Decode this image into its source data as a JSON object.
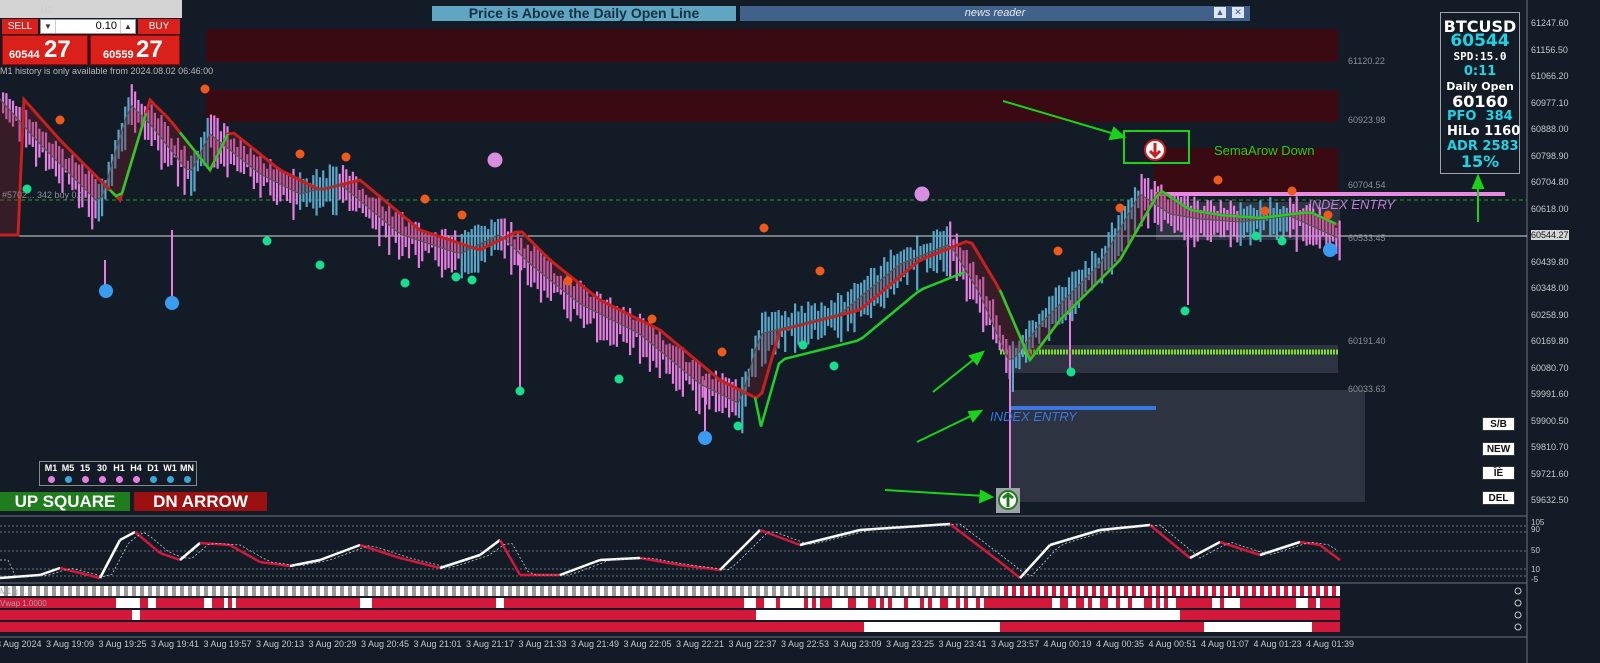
{
  "trade_panel": {
    "symbol_tf": "M1",
    "sell_label": "SELL",
    "buy_label": "BUY",
    "lot_value": "0.10",
    "sell_price_small": "60544",
    "sell_price_big": "27",
    "buy_price_small": "60559",
    "buy_price_big": "27",
    "history_note": "M1 history is only available from 2024.08.02 06:46:00"
  },
  "banner": "Price is Above the Daily Open Line",
  "news_reader": {
    "title": "news reader",
    "minimize_icon": "triangle-up-icon",
    "close_icon": "close-icon"
  },
  "info_panel": {
    "symbol": "BTCUSD",
    "price": "60544",
    "spread": "SPD:15.0",
    "timer": "0:11",
    "daily_open_label": "Daily Open",
    "daily_open_value": "60160",
    "pfo_label": "PFO",
    "pfo_value": "384",
    "hilo_label": "HiLo",
    "hilo_value": "1160",
    "adr_label": "ADR",
    "adr_value": "2583",
    "adr_pct": "15%"
  },
  "buttons": {
    "sb": "S/B",
    "new": "NEW",
    "ie": "ÎÈ",
    "del": "DEL"
  },
  "timeframes": [
    {
      "label": "M1",
      "color": "#e57ee0"
    },
    {
      "label": "M5",
      "color": "#39a9d8"
    },
    {
      "label": "15",
      "color": "#e57ee0"
    },
    {
      "label": "30",
      "color": "#e57ee0"
    },
    {
      "label": "H1",
      "color": "#e57ee0"
    },
    {
      "label": "H4",
      "color": "#e57ee0"
    },
    {
      "label": "D1",
      "color": "#39a9d8"
    },
    {
      "label": "W1",
      "color": "#39a9d8"
    },
    {
      "label": "MN",
      "color": "#39a9d8"
    }
  ],
  "signals": {
    "up": "UP SQUARE",
    "dn": "DN ARROW"
  },
  "annotations": {
    "sema_down": "SemaArow Down",
    "index_entry_top": "INDEX ENTRY",
    "index_entry_bottom": "INDEX ENTRY"
  },
  "order_line_label": "#5702... 342 buy 0.1",
  "price_axis": [
    "61247.60",
    "61156.50",
    "61066.20",
    "60977.10",
    "60888.00",
    "60798.90",
    "60704.80",
    "60618.00",
    "60544.27",
    "60439.80",
    "60348.00",
    "60258.90",
    "60169.80",
    "60080.70",
    "59991.60",
    "59900.50",
    "59810.70",
    "59721.60",
    "59632.50"
  ],
  "level_labels": [
    "61120.22",
    "60923.98",
    "60704.54",
    "60533.45",
    "60191.40",
    "60033.63"
  ],
  "osc_axis": [
    "105",
    "90",
    "50",
    "10",
    "-5"
  ],
  "time_axis": [
    "3 Aug 2024",
    "3 Aug 19:09",
    "3 Aug 19:25",
    "3 Aug 19:41",
    "3 Aug 19:57",
    "3 Aug 20:13",
    "3 Aug 20:29",
    "3 Aug 20:45",
    "3 Aug 21:01",
    "3 Aug 21:17",
    "3 Aug 21:33",
    "3 Aug 21:49",
    "3 Aug 22:05",
    "3 Aug 22:21",
    "3 Aug 22:37",
    "3 Aug 22:53",
    "3 Aug 23:09",
    "3 Aug 23:25",
    "3 Aug 23:41",
    "3 Aug 23:57",
    "4 Aug 00:19",
    "4 Aug 00:35",
    "4 Aug 00:51",
    "4 Aug 01:07",
    "4 Aug 01:23",
    "4 Aug 01:39"
  ],
  "sub_panels": [
    "M1 g ...",
    "Vwap 1.0000"
  ],
  "colors": {
    "bg": "#131c26",
    "bull": "#5aa6c9",
    "bear": "#e57ee0",
    "ma_red": "#c81f1f",
    "ma_green": "#1fd02b",
    "zone": "#3a0a12",
    "accent": "#19d31a"
  }
}
